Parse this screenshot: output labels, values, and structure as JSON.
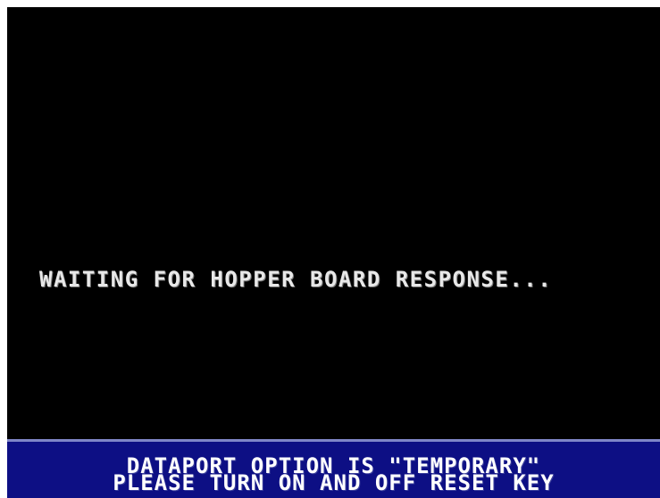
{
  "screen": {
    "status_message": "WAITING FOR HOPPER BOARD RESPONSE...",
    "bottom_bar": {
      "line1": "DATAPORT OPTION IS \"TEMPORARY\"",
      "line2": "PLEASE TURN ON AND OFF RESET KEY"
    }
  },
  "colors": {
    "background": "#000000",
    "text": "#e8e8e8",
    "bottom_bar_background": "#0d0f84",
    "bottom_bar_border": "#7f86c8"
  }
}
